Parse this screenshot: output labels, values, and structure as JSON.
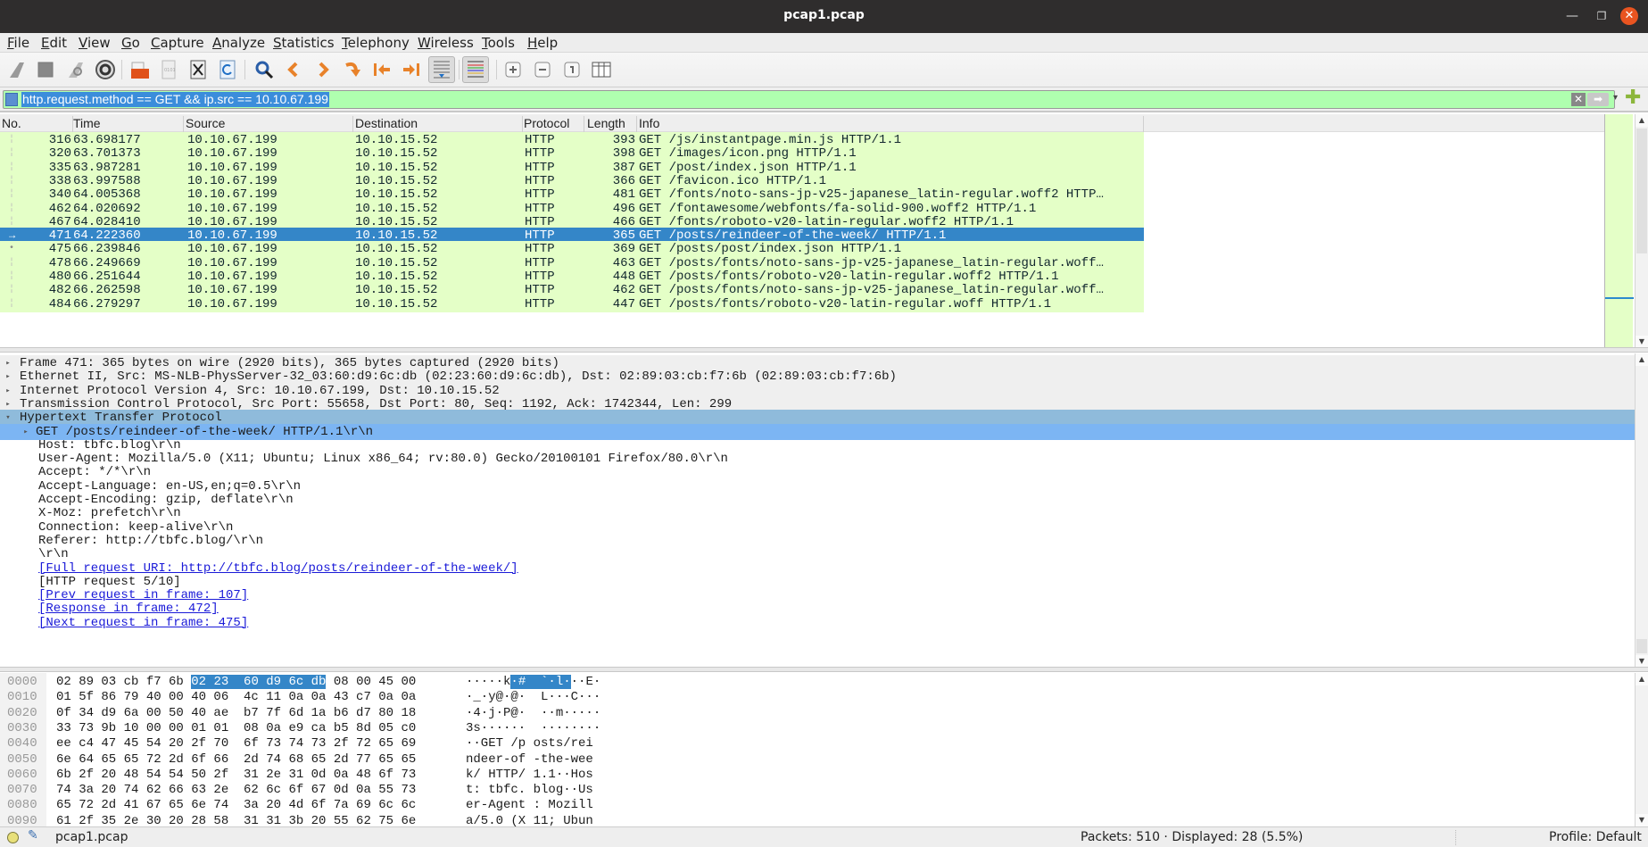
{
  "window": {
    "title": "pcap1.pcap",
    "minimize": "—",
    "maximize": "❐",
    "close": "✕"
  },
  "menu": [
    "File",
    "Edit",
    "View",
    "Go",
    "Capture",
    "Analyze",
    "Statistics",
    "Telephony",
    "Wireless",
    "Tools",
    "Help"
  ],
  "toolbar": {
    "icons": [
      "start-capture",
      "stop-capture",
      "restart-capture",
      "capture-options",
      "open-file",
      "save-file",
      "close-file",
      "reload-file",
      "find-packet",
      "go-back",
      "go-forward",
      "go-to-packet",
      "go-first",
      "go-last",
      "auto-scroll",
      "colorize",
      "zoom-in",
      "zoom-out",
      "normal-size",
      "resize-columns"
    ]
  },
  "filter": {
    "value": "http.request.method == GET && ip.src == 10.10.67.199",
    "clear": "✕",
    "apply": "➡",
    "dropdown": "▾",
    "add": "✚",
    "bg_color": "#afffaf"
  },
  "packet_list": {
    "columns": [
      "No.",
      "Time",
      "Source",
      "Destination",
      "Protocol",
      "Length",
      "Info"
    ],
    "selected_no": "471",
    "rows": [
      {
        "no": "316",
        "time": "63.698177",
        "src": "10.10.67.199",
        "dst": "10.10.15.52",
        "proto": "HTTP",
        "len": "393",
        "info": "GET /js/instantpage.min.js HTTP/1.1"
      },
      {
        "no": "320",
        "time": "63.701373",
        "src": "10.10.67.199",
        "dst": "10.10.15.52",
        "proto": "HTTP",
        "len": "398",
        "info": "GET /images/icon.png HTTP/1.1"
      },
      {
        "no": "335",
        "time": "63.987281",
        "src": "10.10.67.199",
        "dst": "10.10.15.52",
        "proto": "HTTP",
        "len": "387",
        "info": "GET /post/index.json HTTP/1.1"
      },
      {
        "no": "338",
        "time": "63.997588",
        "src": "10.10.67.199",
        "dst": "10.10.15.52",
        "proto": "HTTP",
        "len": "366",
        "info": "GET /favicon.ico HTTP/1.1"
      },
      {
        "no": "340",
        "time": "64.005368",
        "src": "10.10.67.199",
        "dst": "10.10.15.52",
        "proto": "HTTP",
        "len": "481",
        "info": "GET /fonts/noto-sans-jp-v25-japanese_latin-regular.woff2 HTTP…"
      },
      {
        "no": "462",
        "time": "64.020692",
        "src": "10.10.67.199",
        "dst": "10.10.15.52",
        "proto": "HTTP",
        "len": "496",
        "info": "GET /fontawesome/webfonts/fa-solid-900.woff2 HTTP/1.1"
      },
      {
        "no": "467",
        "time": "64.028410",
        "src": "10.10.67.199",
        "dst": "10.10.15.52",
        "proto": "HTTP",
        "len": "466",
        "info": "GET /fonts/roboto-v20-latin-regular.woff2 HTTP/1.1"
      },
      {
        "no": "471",
        "time": "64.222360",
        "src": "10.10.67.199",
        "dst": "10.10.15.52",
        "proto": "HTTP",
        "len": "365",
        "info": "GET /posts/reindeer-of-the-week/ HTTP/1.1"
      },
      {
        "no": "475",
        "time": "66.239846",
        "src": "10.10.67.199",
        "dst": "10.10.15.52",
        "proto": "HTTP",
        "len": "369",
        "info": "GET /posts/post/index.json HTTP/1.1"
      },
      {
        "no": "478",
        "time": "66.249669",
        "src": "10.10.67.199",
        "dst": "10.10.15.52",
        "proto": "HTTP",
        "len": "463",
        "info": "GET /posts/fonts/noto-sans-jp-v25-japanese_latin-regular.woff…"
      },
      {
        "no": "480",
        "time": "66.251644",
        "src": "10.10.67.199",
        "dst": "10.10.15.52",
        "proto": "HTTP",
        "len": "448",
        "info": "GET /posts/fonts/roboto-v20-latin-regular.woff2 HTTP/1.1"
      },
      {
        "no": "482",
        "time": "66.262598",
        "src": "10.10.67.199",
        "dst": "10.10.15.52",
        "proto": "HTTP",
        "len": "462",
        "info": "GET /posts/fonts/noto-sans-jp-v25-japanese_latin-regular.woff…"
      },
      {
        "no": "484",
        "time": "66.279297",
        "src": "10.10.67.199",
        "dst": "10.10.15.52",
        "proto": "HTTP",
        "len": "447",
        "info": "GET /posts/fonts/roboto-v20-latin-regular.woff HTTP/1.1"
      }
    ],
    "row_color": "#e4ffc7",
    "selected_color": "#3486c8"
  },
  "details": [
    {
      "indent": 0,
      "arrow": "▸",
      "text": "Frame 471: 365 bytes on wire (2920 bits), 365 bytes captured (2920 bits)",
      "style": "top"
    },
    {
      "indent": 0,
      "arrow": "▸",
      "text": "Ethernet II, Src: MS-NLB-PhysServer-32_03:60:d9:6c:db (02:23:60:d9:6c:db), Dst: 02:89:03:cb:f7:6b (02:89:03:cb:f7:6b)",
      "style": "top"
    },
    {
      "indent": 0,
      "arrow": "▸",
      "text": "Internet Protocol Version 4, Src: 10.10.67.199, Dst: 10.10.15.52",
      "style": "top"
    },
    {
      "indent": 0,
      "arrow": "▸",
      "text": "Transmission Control Protocol, Src Port: 55658, Dst Port: 80, Seq: 1192, Ack: 1742344, Len: 299",
      "style": "top"
    },
    {
      "indent": 0,
      "arrow": "▾",
      "text": "Hypertext Transfer Protocol",
      "style": "hl"
    },
    {
      "indent": 1,
      "arrow": "▸",
      "text": "GET /posts/reindeer-of-the-week/ HTTP/1.1\\r\\n",
      "style": "hl2"
    },
    {
      "indent": 1,
      "arrow": "",
      "text": "Host: tbfc.blog\\r\\n",
      "style": ""
    },
    {
      "indent": 1,
      "arrow": "",
      "text": "User-Agent: Mozilla/5.0 (X11; Ubuntu; Linux x86_64; rv:80.0) Gecko/20100101 Firefox/80.0\\r\\n",
      "style": ""
    },
    {
      "indent": 1,
      "arrow": "",
      "text": "Accept: */*\\r\\n",
      "style": ""
    },
    {
      "indent": 1,
      "arrow": "",
      "text": "Accept-Language: en-US,en;q=0.5\\r\\n",
      "style": ""
    },
    {
      "indent": 1,
      "arrow": "",
      "text": "Accept-Encoding: gzip, deflate\\r\\n",
      "style": ""
    },
    {
      "indent": 1,
      "arrow": "",
      "text": "X-Moz: prefetch\\r\\n",
      "style": ""
    },
    {
      "indent": 1,
      "arrow": "",
      "text": "Connection: keep-alive\\r\\n",
      "style": ""
    },
    {
      "indent": 1,
      "arrow": "",
      "text": "Referer: http://tbfc.blog/\\r\\n",
      "style": ""
    },
    {
      "indent": 1,
      "arrow": "",
      "text": "\\r\\n",
      "style": ""
    },
    {
      "indent": 1,
      "arrow": "",
      "text": "[Full request URI: http://tbfc.blog/posts/reindeer-of-the-week/]",
      "style": "link"
    },
    {
      "indent": 1,
      "arrow": "",
      "text": "[HTTP request 5/10]",
      "style": ""
    },
    {
      "indent": 1,
      "arrow": "",
      "text": "[Prev request in frame: 107]",
      "style": "link"
    },
    {
      "indent": 1,
      "arrow": "",
      "text": "[Response in frame: 472]",
      "style": "link"
    },
    {
      "indent": 1,
      "arrow": "",
      "text": "[Next request in frame: 475]",
      "style": "link"
    }
  ],
  "hex": [
    {
      "off": "0000",
      "b1": "02 89 03 cb f7 6b ",
      "sel": "02 23  60 d9 6c db",
      "b2": " 08 00 45 00",
      "a1": "·····k",
      "asel": "·#  `·l·",
      "a2": "··E·"
    },
    {
      "off": "0010",
      "b1": "01 5f 86 79 40 00 40 06  4c 11 0a 0a 43 c7 0a 0a",
      "sel": "",
      "b2": "",
      "a1": "·_·y@·@·  L···C···",
      "asel": "",
      "a2": ""
    },
    {
      "off": "0020",
      "b1": "0f 34 d9 6a 00 50 40 ae  b7 7f 6d 1a b6 d7 80 18",
      "sel": "",
      "b2": "",
      "a1": "·4·j·P@·  ··m·····",
      "asel": "",
      "a2": ""
    },
    {
      "off": "0030",
      "b1": "33 73 9b 10 00 00 01 01  08 0a e9 ca b5 8d 05 c0",
      "sel": "",
      "b2": "",
      "a1": "3s······  ········",
      "asel": "",
      "a2": ""
    },
    {
      "off": "0040",
      "b1": "ee c4 47 45 54 20 2f 70  6f 73 74 73 2f 72 65 69",
      "sel": "",
      "b2": "",
      "a1": "··GET /p osts/rei",
      "asel": "",
      "a2": ""
    },
    {
      "off": "0050",
      "b1": "6e 64 65 65 72 2d 6f 66  2d 74 68 65 2d 77 65 65",
      "sel": "",
      "b2": "",
      "a1": "ndeer-of -the-wee",
      "asel": "",
      "a2": ""
    },
    {
      "off": "0060",
      "b1": "6b 2f 20 48 54 54 50 2f  31 2e 31 0d 0a 48 6f 73",
      "sel": "",
      "b2": "",
      "a1": "k/ HTTP/ 1.1··Hos",
      "asel": "",
      "a2": ""
    },
    {
      "off": "0070",
      "b1": "74 3a 20 74 62 66 63 2e  62 6c 6f 67 0d 0a 55 73",
      "sel": "",
      "b2": "",
      "a1": "t: tbfc. blog··Us",
      "asel": "",
      "a2": ""
    },
    {
      "off": "0080",
      "b1": "65 72 2d 41 67 65 6e 74  3a 20 4d 6f 7a 69 6c 6c",
      "sel": "",
      "b2": "",
      "a1": "er-Agent : Mozill",
      "asel": "",
      "a2": ""
    },
    {
      "off": "0090",
      "b1": "61 2f 35 2e 30 20 28 58  31 31 3b 20 55 62 75 6e",
      "sel": "",
      "b2": "",
      "a1": "a/5.0 (X 11; Ubun",
      "asel": "",
      "a2": ""
    }
  ],
  "status": {
    "file": "pcap1.pcap",
    "packets": "Packets: 510 · Displayed: 28 (5.5%)",
    "profile": "Profile: Default"
  }
}
